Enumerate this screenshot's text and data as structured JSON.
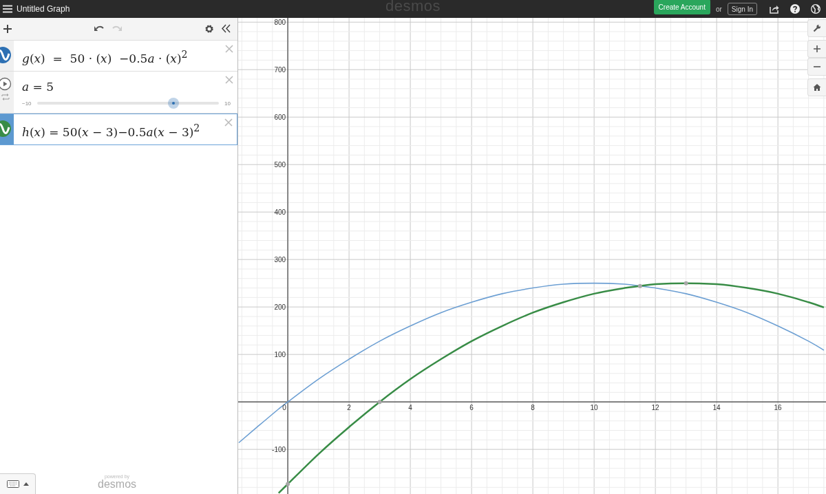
{
  "top_bar": {
    "title": "Untitled Graph",
    "logo": "desmos",
    "create_account": "Create Account",
    "or": "or",
    "sign_in": "Sign In"
  },
  "expressions": [
    {
      "kind": "function",
      "color": "#2d70b3",
      "latex": "𝑔(𝑥)  =  50 · (𝑥)  −0.5𝑎 · (𝑥)$^{2}$",
      "selected": false
    },
    {
      "kind": "slider",
      "latex": "𝑎 = 5",
      "min": "−10",
      "max": "10",
      "level": 0.75,
      "selected": false
    },
    {
      "kind": "function",
      "color": "#388c46",
      "latex": "ℎ(𝑥) = 50(𝑥 − 3)−0.5𝑎(𝑥 − 3)$^{2}$",
      "selected": true
    }
  ],
  "footer": {
    "powered_by": "powered by",
    "brand": "desmos"
  },
  "graph": {
    "chart_data": {
      "type": "line",
      "grid": true,
      "x": [
        -1.6,
        -1,
        -0.3,
        0,
        1,
        2,
        3,
        4,
        5,
        6,
        7,
        8,
        9,
        10,
        11,
        11.5,
        12,
        13,
        14,
        15,
        16,
        17,
        17.5
      ],
      "series": [
        {
          "color": "#6c9fd3",
          "values": [
            -86,
            -53,
            -15,
            0,
            48,
            90,
            128,
            160,
            188,
            210,
            228,
            240,
            248,
            250,
            248,
            244,
            240,
            228,
            210,
            188,
            160,
            128,
            109
          ]
        },
        {
          "color": "#388c46",
          "values": [
            null,
            null,
            -192,
            -173,
            -110,
            -53,
            0,
            48,
            90,
            128,
            160,
            188,
            210,
            228,
            240,
            244,
            248,
            250,
            248,
            240,
            228,
            210,
            199
          ]
        }
      ],
      "xlim": [
        -1.62,
        17.57
      ],
      "ylim": [
        -194,
        809
      ],
      "xticks": [
        0,
        2,
        4,
        6,
        8,
        10,
        12,
        14,
        16
      ],
      "yticks": [
        -100,
        100,
        200,
        300,
        400,
        500,
        600,
        700,
        800
      ]
    }
  }
}
